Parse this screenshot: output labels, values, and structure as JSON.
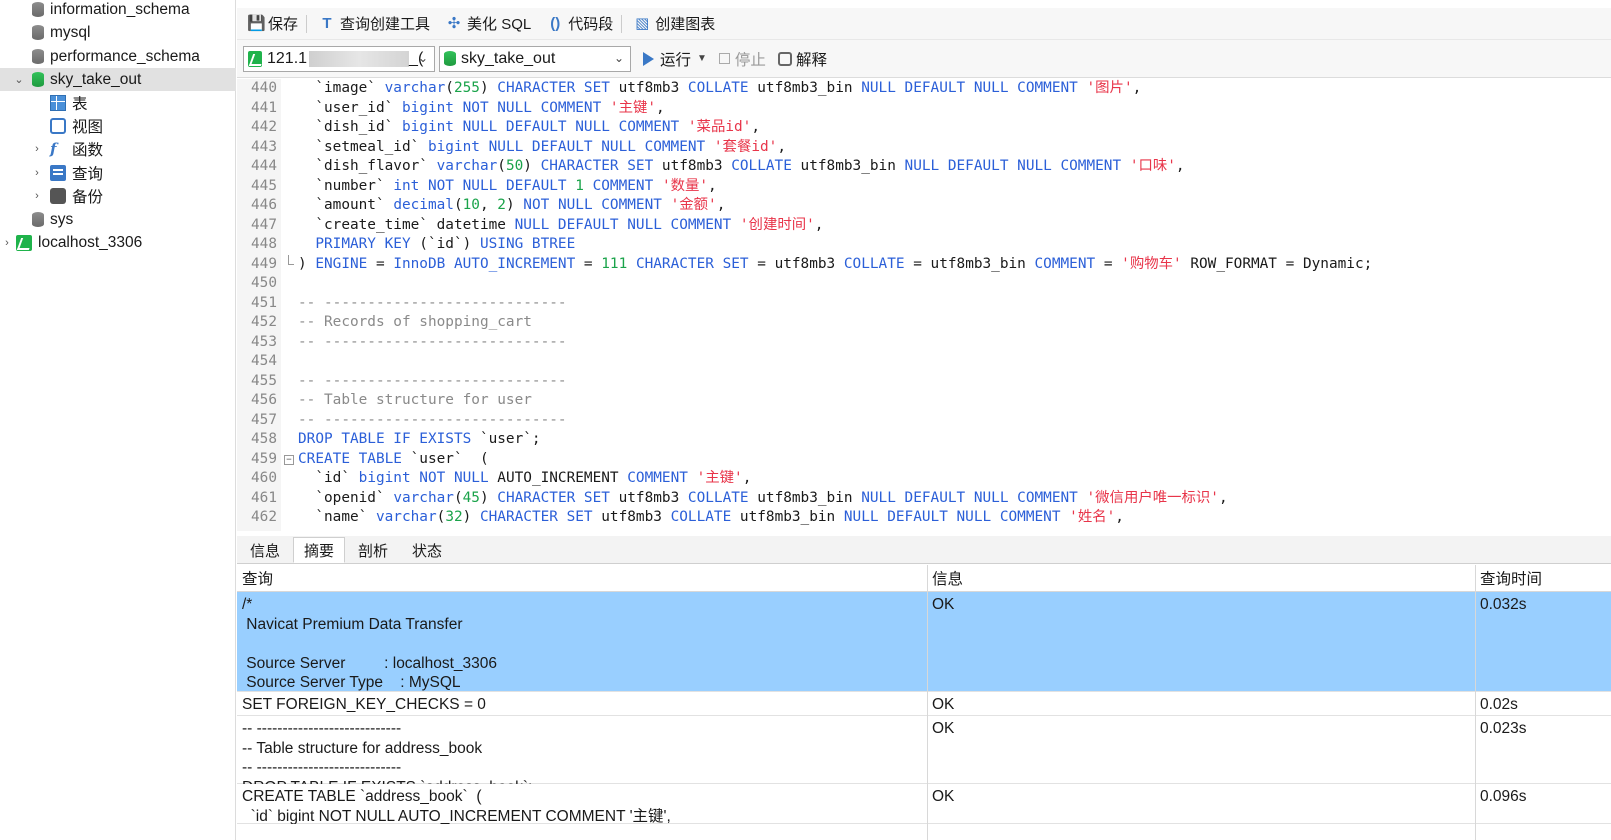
{
  "sidebar": {
    "items": [
      {
        "label": "information_schema",
        "icon": "database-icon"
      },
      {
        "label": "mysql",
        "icon": "database-icon"
      },
      {
        "label": "performance_schema",
        "icon": "database-icon"
      },
      {
        "label": "sky_take_out",
        "icon": "database-open-icon"
      },
      {
        "label": "表",
        "icon": "table-icon"
      },
      {
        "label": "视图",
        "icon": "view-icon"
      },
      {
        "label": "函数",
        "icon": "function-icon"
      },
      {
        "label": "查询",
        "icon": "query-icon"
      },
      {
        "label": "备份",
        "icon": "backup-icon"
      },
      {
        "label": "sys",
        "icon": "database-icon"
      },
      {
        "label": "localhost_3306",
        "icon": "connection-icon"
      }
    ]
  },
  "toolbar": {
    "save": "保存",
    "query_builder": "查询创建工具",
    "beautify": "美化 SQL",
    "snippet": "代码段",
    "chart": "创建图表",
    "connection_value": "121.1",
    "connection_suffix": "_(",
    "database_value": "sky_take_out",
    "run": "运行",
    "stop": "停止",
    "explain": "解释"
  },
  "editor": {
    "lines": [
      {
        "n": "440",
        "t": [
          [
            "",
            "  `image` "
          ],
          [
            "kw",
            "varchar"
          ],
          [
            "",
            "("
          ],
          [
            "num",
            "255"
          ],
          [
            "",
            ") "
          ],
          [
            "kw",
            "CHARACTER SET"
          ],
          [
            "",
            " utf8mb3 "
          ],
          [
            "kw",
            "COLLATE"
          ],
          [
            "",
            " utf8mb3_bin "
          ],
          [
            "kw",
            "NULL DEFAULT NULL COMMENT"
          ],
          [
            "",
            " "
          ],
          [
            "str",
            "'图片'"
          ],
          [
            "",
            ","
          ]
        ]
      },
      {
        "n": "441",
        "t": [
          [
            "",
            "  `user_id` "
          ],
          [
            "kw",
            "bigint NOT NULL COMMENT"
          ],
          [
            "",
            " "
          ],
          [
            "str",
            "'主键'"
          ],
          [
            "",
            ","
          ]
        ]
      },
      {
        "n": "442",
        "t": [
          [
            "",
            "  `dish_id` "
          ],
          [
            "kw",
            "bigint NULL DEFAULT NULL COMMENT"
          ],
          [
            "",
            " "
          ],
          [
            "str",
            "'菜品id'"
          ],
          [
            "",
            ","
          ]
        ]
      },
      {
        "n": "443",
        "t": [
          [
            "",
            "  `setmeal_id` "
          ],
          [
            "kw",
            "bigint NULL DEFAULT NULL COMMENT"
          ],
          [
            "",
            " "
          ],
          [
            "str",
            "'套餐id'"
          ],
          [
            "",
            ","
          ]
        ]
      },
      {
        "n": "444",
        "t": [
          [
            "",
            "  `dish_flavor` "
          ],
          [
            "kw",
            "varchar"
          ],
          [
            "",
            "("
          ],
          [
            "num",
            "50"
          ],
          [
            "",
            ") "
          ],
          [
            "kw",
            "CHARACTER SET"
          ],
          [
            "",
            " utf8mb3 "
          ],
          [
            "kw",
            "COLLATE"
          ],
          [
            "",
            " utf8mb3_bin "
          ],
          [
            "kw",
            "NULL DEFAULT NULL COMMENT"
          ],
          [
            "",
            " "
          ],
          [
            "str",
            "'口味'"
          ],
          [
            "",
            ","
          ]
        ]
      },
      {
        "n": "445",
        "t": [
          [
            "",
            "  `number` "
          ],
          [
            "kw",
            "int NOT NULL DEFAULT"
          ],
          [
            "",
            " "
          ],
          [
            "num",
            "1"
          ],
          [
            "",
            " "
          ],
          [
            "kw",
            "COMMENT"
          ],
          [
            "",
            " "
          ],
          [
            "str",
            "'数量'"
          ],
          [
            "",
            ","
          ]
        ]
      },
      {
        "n": "446",
        "t": [
          [
            "",
            "  `amount` "
          ],
          [
            "kw",
            "decimal"
          ],
          [
            "",
            "("
          ],
          [
            "num",
            "10"
          ],
          [
            "",
            ", "
          ],
          [
            "num",
            "2"
          ],
          [
            "",
            ") "
          ],
          [
            "kw",
            "NOT NULL COMMENT"
          ],
          [
            "",
            " "
          ],
          [
            "str",
            "'金额'"
          ],
          [
            "",
            ","
          ]
        ]
      },
      {
        "n": "447",
        "t": [
          [
            "",
            "  `create_time` datetime "
          ],
          [
            "kw",
            "NULL DEFAULT NULL COMMENT"
          ],
          [
            "",
            " "
          ],
          [
            "str",
            "'创建时间'"
          ],
          [
            "",
            ","
          ]
        ]
      },
      {
        "n": "448",
        "t": [
          [
            "",
            "  "
          ],
          [
            "kw",
            "PRIMARY KEY"
          ],
          [
            "",
            " (`id`) "
          ],
          [
            "kw",
            "USING BTREE"
          ]
        ]
      },
      {
        "n": "449",
        "t": [
          [
            "",
            ") "
          ],
          [
            "kw",
            "ENGINE"
          ],
          [
            "",
            " = "
          ],
          [
            "kw",
            "InnoDB AUTO_INCREMENT"
          ],
          [
            "",
            " = "
          ],
          [
            "num",
            "111"
          ],
          [
            "",
            " "
          ],
          [
            "kw",
            "CHARACTER SET"
          ],
          [
            "",
            " = utf8mb3 "
          ],
          [
            "kw",
            "COLLATE"
          ],
          [
            "",
            " = utf8mb3_bin "
          ],
          [
            "kw",
            "COMMENT"
          ],
          [
            "",
            " = "
          ],
          [
            "str",
            "'购物车'"
          ],
          [
            "",
            " ROW_FORMAT = Dynamic;"
          ]
        ]
      },
      {
        "n": "450",
        "t": []
      },
      {
        "n": "451",
        "t": [
          [
            "cm",
            "-- ----------------------------"
          ]
        ]
      },
      {
        "n": "452",
        "t": [
          [
            "cm",
            "-- Records of shopping_cart"
          ]
        ]
      },
      {
        "n": "453",
        "t": [
          [
            "cm",
            "-- ----------------------------"
          ]
        ]
      },
      {
        "n": "454",
        "t": []
      },
      {
        "n": "455",
        "t": [
          [
            "cm",
            "-- ----------------------------"
          ]
        ]
      },
      {
        "n": "456",
        "t": [
          [
            "cm",
            "-- Table structure for user"
          ]
        ]
      },
      {
        "n": "457",
        "t": [
          [
            "cm",
            "-- ----------------------------"
          ]
        ]
      },
      {
        "n": "458",
        "t": [
          [
            "kw",
            "DROP TABLE IF EXISTS"
          ],
          [
            "",
            " `user`;"
          ]
        ]
      },
      {
        "n": "459",
        "t": [
          [
            "kw",
            "CREATE TABLE"
          ],
          [
            "",
            " `user`  ("
          ]
        ]
      },
      {
        "n": "460",
        "t": [
          [
            "",
            "  `id` "
          ],
          [
            "kw",
            "bigint NOT NULL"
          ],
          [
            "",
            " AUTO_INCREMENT "
          ],
          [
            "kw",
            "COMMENT"
          ],
          [
            "",
            " "
          ],
          [
            "str",
            "'主键'"
          ],
          [
            "",
            ","
          ]
        ]
      },
      {
        "n": "461",
        "t": [
          [
            "",
            "  `openid` "
          ],
          [
            "kw",
            "varchar"
          ],
          [
            "",
            "("
          ],
          [
            "num",
            "45"
          ],
          [
            "",
            ") "
          ],
          [
            "kw",
            "CHARACTER SET"
          ],
          [
            "",
            " utf8mb3 "
          ],
          [
            "kw",
            "COLLATE"
          ],
          [
            "",
            " utf8mb3_bin "
          ],
          [
            "kw",
            "NULL DEFAULT NULL COMMENT"
          ],
          [
            "",
            " "
          ],
          [
            "str",
            "'微信用户唯一标识'"
          ],
          [
            "",
            ","
          ]
        ]
      },
      {
        "n": "462",
        "t": [
          [
            "",
            "  `name` "
          ],
          [
            "kw",
            "varchar"
          ],
          [
            "",
            "("
          ],
          [
            "num",
            "32"
          ],
          [
            "",
            ") "
          ],
          [
            "kw",
            "CHARACTER SET"
          ],
          [
            "",
            " utf8mb3 "
          ],
          [
            "kw",
            "COLLATE"
          ],
          [
            "",
            " utf8mb3_bin "
          ],
          [
            "kw",
            "NULL DEFAULT NULL COMMENT"
          ],
          [
            "",
            " "
          ],
          [
            "str",
            "'姓名'"
          ],
          [
            "",
            ","
          ]
        ]
      }
    ]
  },
  "result_tabs": [
    "信息",
    "摘要",
    "剖析",
    "状态"
  ],
  "active_result_tab": "摘要",
  "grid": {
    "headers": [
      "查询",
      "信息",
      "查询时间"
    ],
    "rows": [
      {
        "query": "/*\n Navicat Premium Data Transfer\n\n Source Server         : localhost_3306\n Source Server Type    : MySQL",
        "info": "OK",
        "time": "0.032s",
        "selected": true
      },
      {
        "query": "SET FOREIGN_KEY_CHECKS = 0",
        "info": "OK",
        "time": "0.02s",
        "selected": false
      },
      {
        "query": "-- ----------------------------\n-- Table structure for address_book\n-- ----------------------------\nDROP TABLE IF EXISTS `address_book`;",
        "info": "OK",
        "time": "0.023s",
        "selected": false
      },
      {
        "query": "CREATE TABLE `address_book`  (\n  `id` bigint NOT NULL AUTO_INCREMENT COMMENT '主键',",
        "info": "OK",
        "time": "0.096s",
        "selected": false
      }
    ]
  },
  "colors": {
    "keyword": "#2b5fd8",
    "string": "#e8354a",
    "number": "#1aa34a",
    "comment": "#8a8a8a",
    "selection": "#99cfff"
  }
}
